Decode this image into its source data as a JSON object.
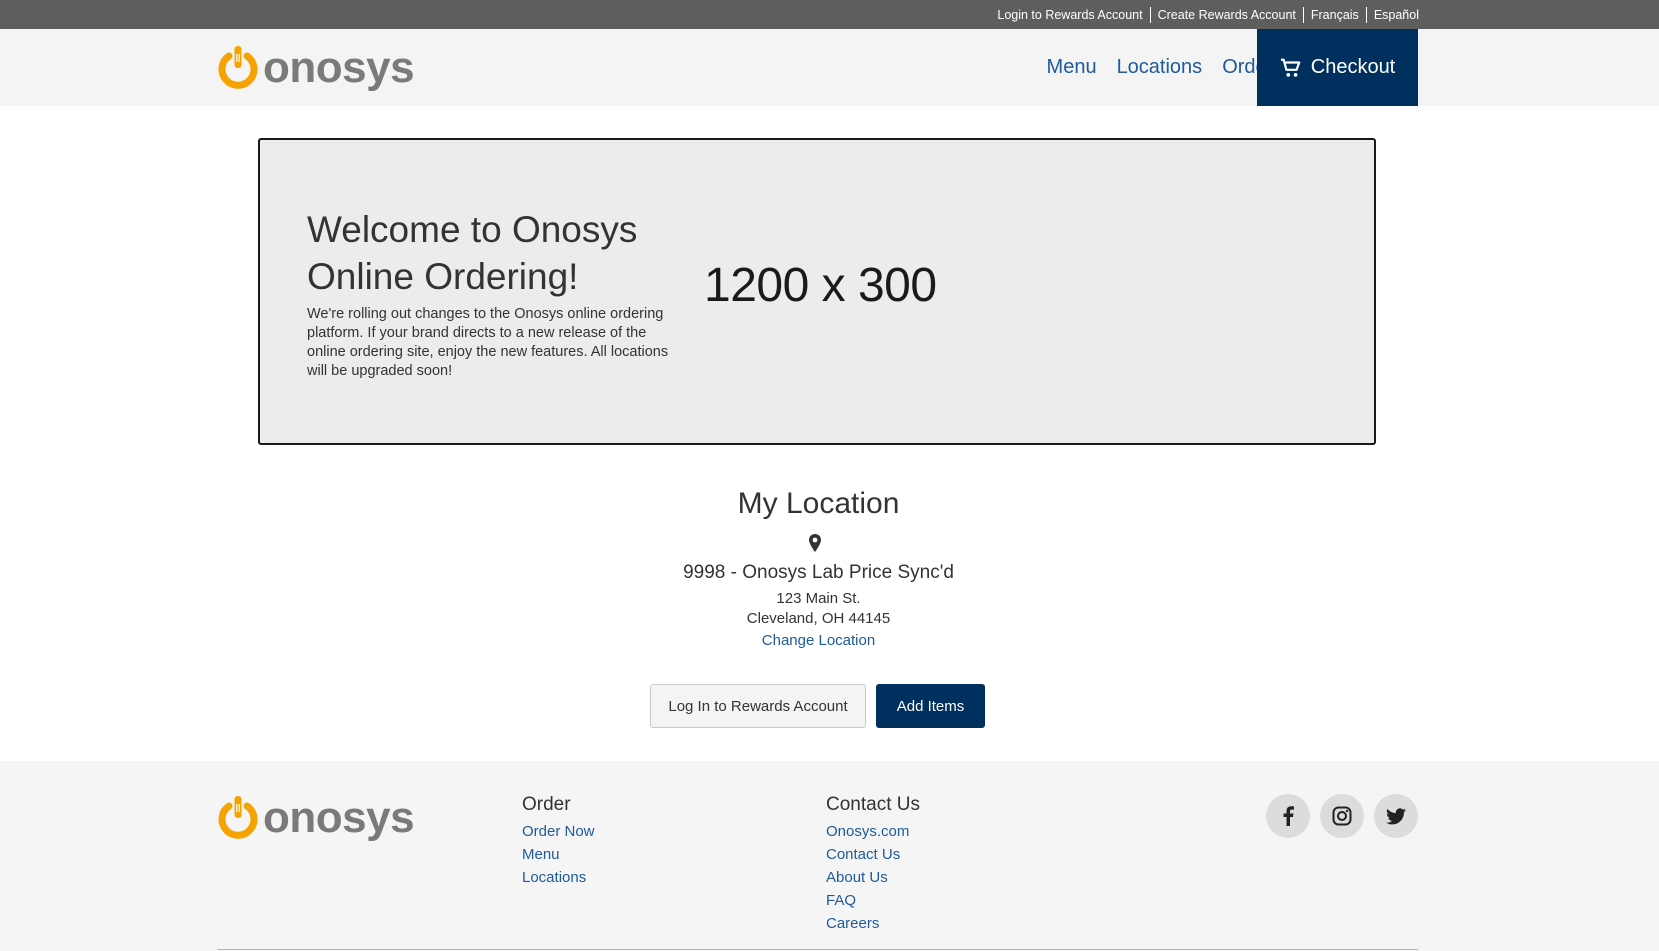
{
  "topbar": {
    "links": [
      "Login to Rewards Account",
      "Create Rewards Account",
      "Français",
      "Español"
    ]
  },
  "brand": {
    "name": "onosys"
  },
  "nav": {
    "items": [
      "Menu",
      "Locations",
      "Order Details"
    ],
    "checkout_label": "Checkout"
  },
  "hero": {
    "title": "Welcome to Onosys Online Ordering!",
    "text": "We're rolling out changes to the Onosys online ordering platform. If your brand directs to a new release of the online ordering site, enjoy the new features. All locations will be upgraded soon!",
    "placeholder": "1200 x 300"
  },
  "location": {
    "title": "My Location",
    "icon": "map-pin-icon",
    "name": "9998 - Onosys Lab Price Sync'd",
    "address_line1": "123 Main St.",
    "address_line2": "Cleveland, OH 44145",
    "change_label": "Change Location"
  },
  "actions": {
    "login_label": "Log In to Rewards Account",
    "add_label": "Add Items"
  },
  "footer": {
    "order": {
      "title": "Order",
      "links": [
        "Order Now",
        "Menu",
        "Locations"
      ]
    },
    "contact": {
      "title": "Contact Us",
      "links": [
        "Onosys.com",
        "Contact Us",
        "About Us",
        "FAQ",
        "Careers"
      ]
    },
    "socials": [
      "facebook-icon",
      "instagram-icon",
      "twitter-icon"
    ]
  },
  "colors": {
    "brand_orange": "#f5a300",
    "navy": "#00305e",
    "link_blue": "#1f5a9a",
    "topbar_gray": "#5e5e5e"
  }
}
